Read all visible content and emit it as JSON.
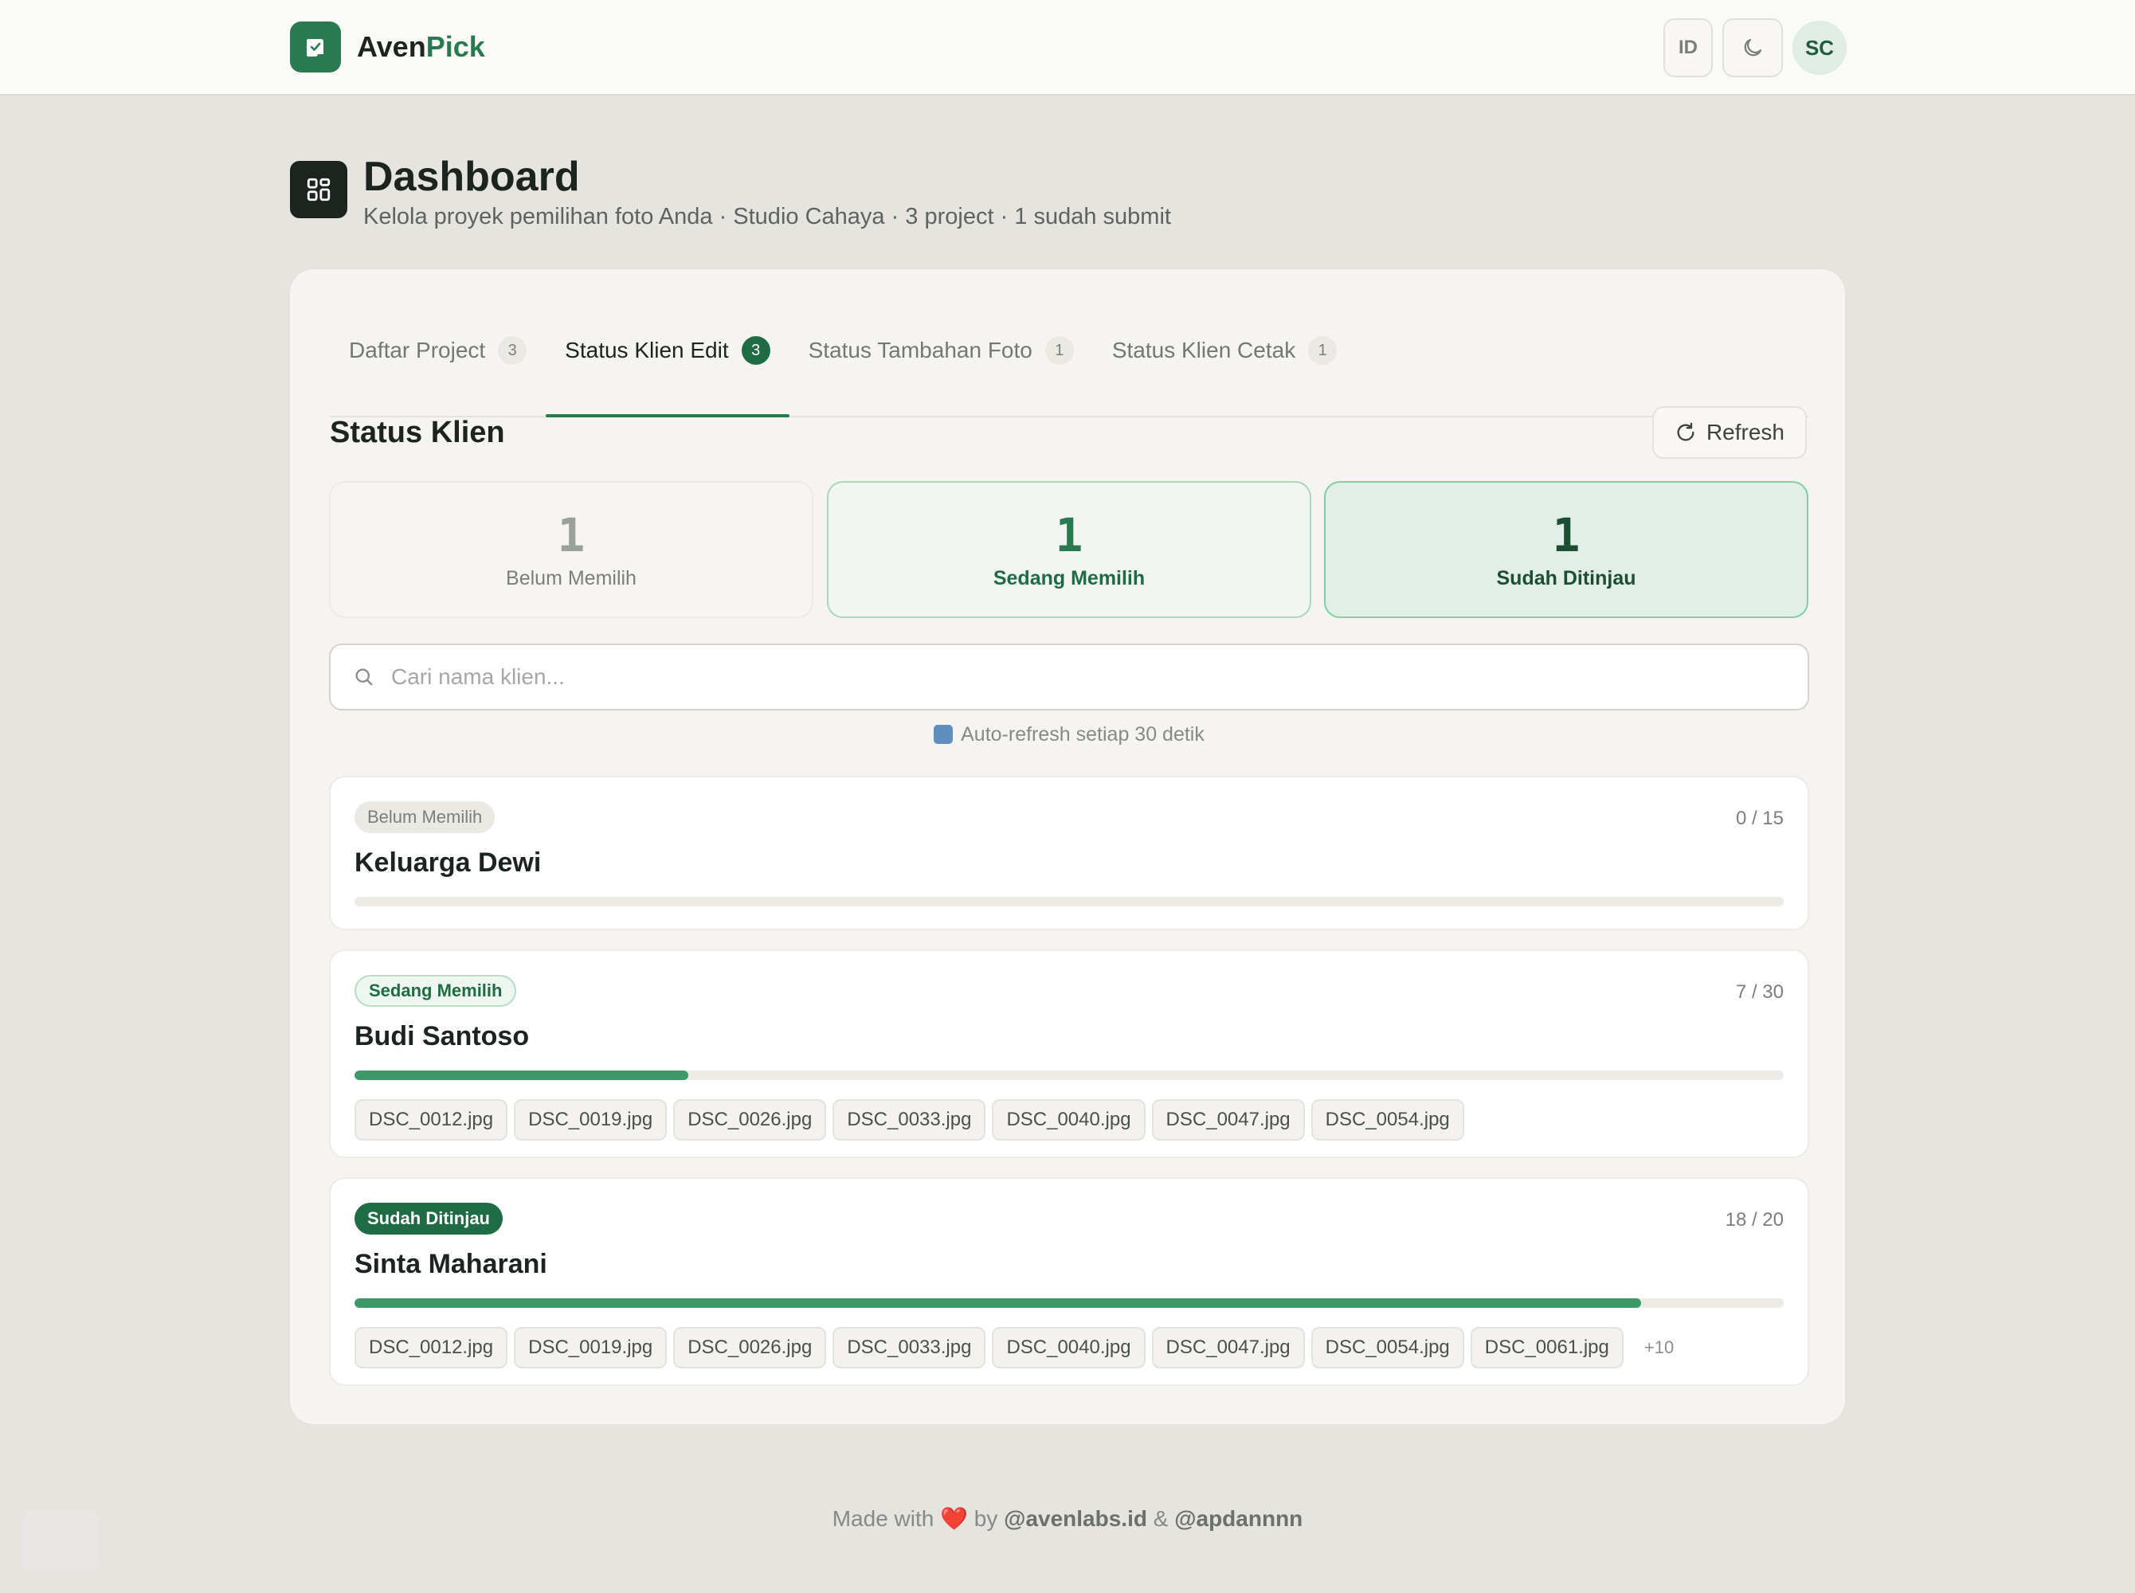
{
  "app": {
    "brand_first": "Aven",
    "brand_second": "Pick",
    "lang_label": "ID",
    "avatar_initials": "SC"
  },
  "page": {
    "title": "Dashboard",
    "subtitle": "Kelola proyek pemilihan foto Anda · Studio Cahaya · 3 project · 1 sudah submit"
  },
  "tabs": [
    {
      "label": "Daftar Project",
      "count": "3"
    },
    {
      "label": "Status Klien Edit",
      "count": "3"
    },
    {
      "label": "Status Tambahan Foto",
      "count": "1"
    },
    {
      "label": "Status Klien Cetak",
      "count": "1"
    }
  ],
  "section": {
    "title": "Status Klien",
    "refresh_label": "Refresh"
  },
  "stats": [
    {
      "value": "1",
      "label": "Belum Memilih"
    },
    {
      "value": "1",
      "label": "Sedang Memilih"
    },
    {
      "value": "1",
      "label": "Sudah Ditinjau"
    }
  ],
  "search": {
    "placeholder": "Cari nama klien...",
    "value": ""
  },
  "auto_refresh": "Auto-refresh setiap 30 detik",
  "clients": [
    {
      "status": "Belum Memilih",
      "name": "Keluarga Dewi",
      "progress": "0 / 15",
      "selected": 0,
      "total": 15,
      "files": []
    },
    {
      "status": "Sedang Memilih",
      "name": "Budi Santoso",
      "progress": "7 / 30",
      "selected": 7,
      "total": 30,
      "files": [
        "DSC_0012.jpg",
        "DSC_0019.jpg",
        "DSC_0026.jpg",
        "DSC_0033.jpg",
        "DSC_0040.jpg",
        "DSC_0047.jpg",
        "DSC_0054.jpg"
      ]
    },
    {
      "status": "Sudah Ditinjau",
      "name": "Sinta Maharani",
      "progress": "18 / 20",
      "selected": 18,
      "total": 20,
      "files": [
        "DSC_0012.jpg",
        "DSC_0019.jpg",
        "DSC_0026.jpg",
        "DSC_0033.jpg",
        "DSC_0040.jpg",
        "DSC_0047.jpg",
        "DSC_0054.jpg",
        "DSC_0061.jpg"
      ],
      "more": "+10"
    }
  ],
  "footer": {
    "made_with": "Made with",
    "heart": "❤️",
    "by": "by",
    "handle1": "@avenlabs.id",
    "amp": "&",
    "handle2": "@apdannnn"
  },
  "colors": {
    "brand": "#2a7a4f",
    "progress": "#3d9a68",
    "background": "#e6e4df"
  }
}
